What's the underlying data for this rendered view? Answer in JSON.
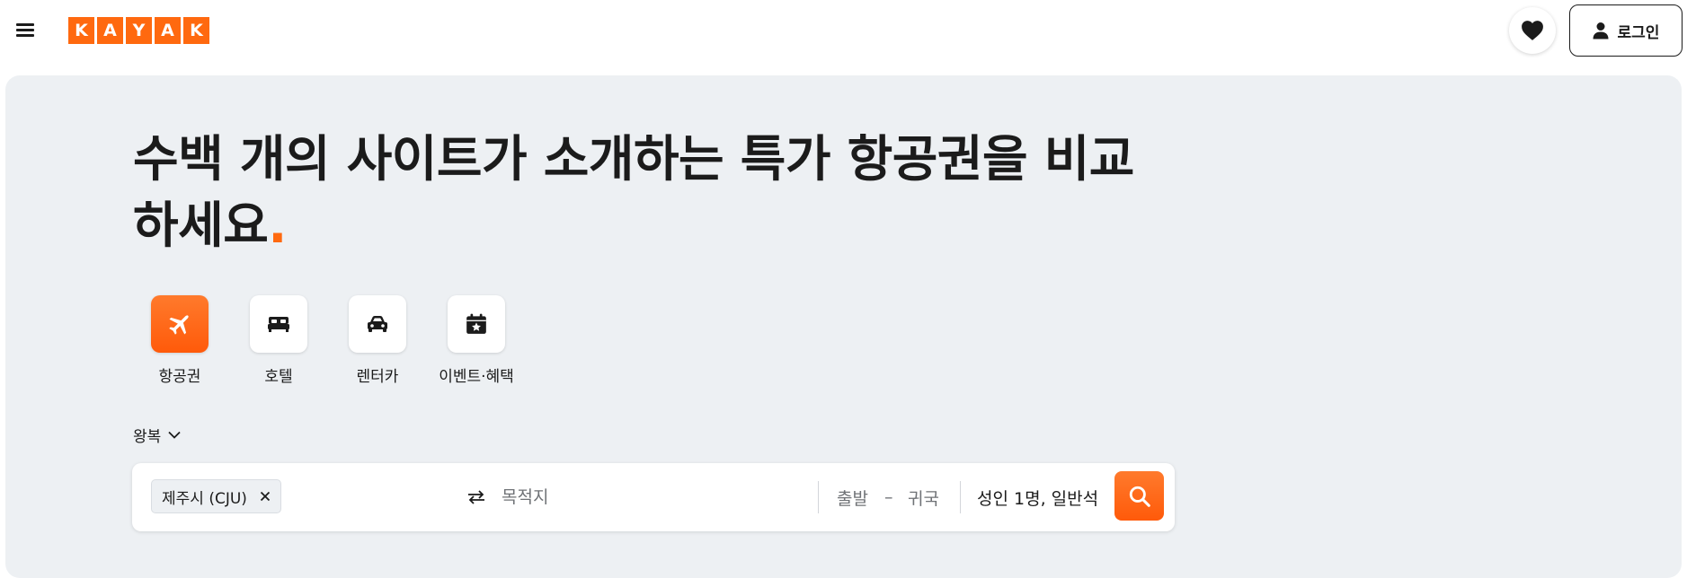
{
  "header": {
    "logo_letters": [
      "K",
      "A",
      "Y",
      "A",
      "K"
    ],
    "login_label": "로그인",
    "icons": {
      "menu": "menu-icon",
      "favorites": "heart-icon",
      "user": "person-icon"
    }
  },
  "hero": {
    "headline_line1": "수백 개의 사이트가 소개하는 특가 항공권을 비교",
    "headline_line2": "하세요",
    "headline_dot": "."
  },
  "verticals": [
    {
      "label": "항공권",
      "icon": "airplane-icon",
      "active": true
    },
    {
      "label": "호텔",
      "icon": "bed-icon",
      "active": false
    },
    {
      "label": "렌터카",
      "icon": "car-icon",
      "active": false
    },
    {
      "label": "이벤트·혜택",
      "icon": "calendar-star-icon",
      "active": false
    }
  ],
  "search": {
    "trip_type": "왕복",
    "origin": "제주시 (CJU)",
    "destination_placeholder": "목적지",
    "depart_placeholder": "출발",
    "date_separator": "–",
    "return_placeholder": "귀국",
    "passengers": "성인 1명, 일반석"
  },
  "colors": {
    "accent": "#ff690f",
    "hero_bg": "#edf0f3",
    "text": "#1b1b1b",
    "muted": "#6f7276"
  }
}
